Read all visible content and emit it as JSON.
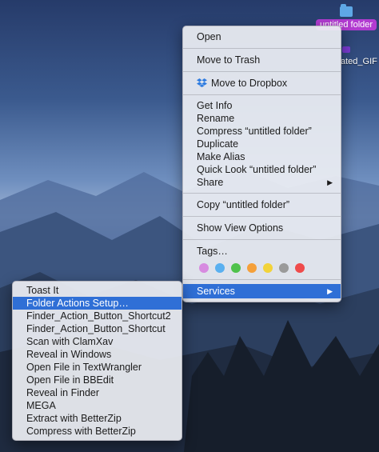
{
  "desktop": {
    "folder_label": "untitled folder",
    "gif_label": "ated_GIF"
  },
  "context_menu": {
    "open": "Open",
    "move_to_trash": "Move to Trash",
    "move_to_dropbox": "Move to Dropbox",
    "get_info": "Get Info",
    "rename": "Rename",
    "compress": "Compress “untitled folder”",
    "duplicate": "Duplicate",
    "make_alias": "Make Alias",
    "quick_look": "Quick Look “untitled folder”",
    "share": "Share",
    "copy": "Copy “untitled folder”",
    "show_view_options": "Show View Options",
    "tags": "Tags…",
    "services": "Services",
    "tag_colors": [
      "#d78be0",
      "#5ab0f0",
      "#4fc24c",
      "#f5a03a",
      "#f2d33a",
      "#9a9a9a",
      "#ef4b4b"
    ]
  },
  "services_submenu": {
    "items": [
      "Toast It",
      "Folder Actions Setup…",
      "Finder_Action_Button_Shortcut2",
      "Finder_Action_Button_Shortcut",
      "Scan with ClamXav",
      "Reveal in Windows",
      "Open File in TextWrangler",
      "Open File in BBEdit",
      "Reveal in Finder",
      "MEGA",
      "Extract with BetterZip",
      "Compress with BetterZip"
    ],
    "highlighted_index": 1
  },
  "colors": {
    "highlight": "#2f6fd6",
    "folder_label_bg": "#b23bd1"
  }
}
